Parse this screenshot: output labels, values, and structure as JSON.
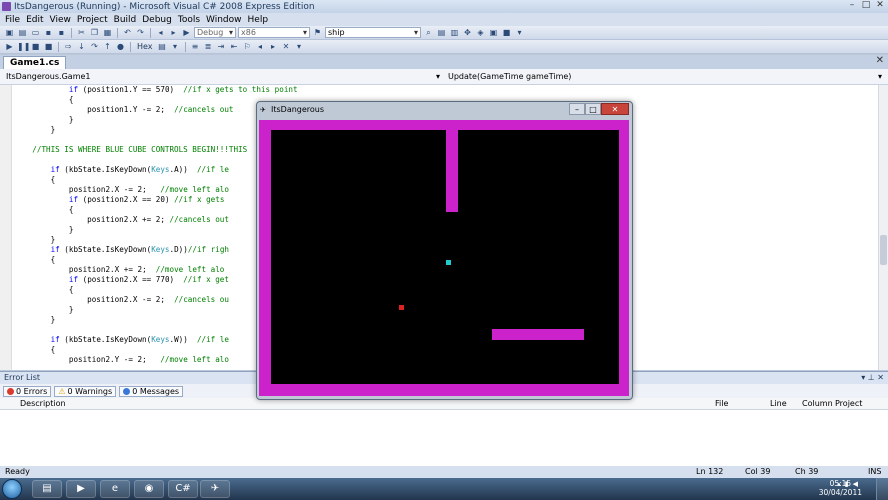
{
  "window": {
    "title": "ItsDangerous (Running) - Microsoft Visual C# 2008 Express Edition"
  },
  "menu": [
    "File",
    "Edit",
    "View",
    "Project",
    "Build",
    "Debug",
    "Tools",
    "Window",
    "Help"
  ],
  "toolbar": {
    "config_value": "Debug",
    "platform_value": "x86",
    "find_value": "ship",
    "hex_label": "Hex"
  },
  "doc_tab": {
    "label": "Game1.cs"
  },
  "nav": {
    "class_combo": "ItsDangerous.Game1",
    "method_combo": "Update(GameTime gameTime)"
  },
  "code_lines": [
    "            if (position1.Y == 570)  //if x gets to this point",
    "            {",
    "                position1.Y -= 2;  //cancels out",
    "            }",
    "        }",
    "",
    "    //THIS IS WHERE BLUE CUBE CONTROLS BEGIN!!!THIS",
    "",
    "        if (kbState.IsKeyDown(Keys.A))  //if le",
    "        {",
    "            position2.X -= 2;   //move left alo",
    "            if (position2.X == 20) //if x gets",
    "            {",
    "                position2.X += 2; //cancels out",
    "            }",
    "        }",
    "        if (kbState.IsKeyDown(Keys.D))//if righ",
    "        {",
    "            position2.X += 2;  //move left alo",
    "            if (position2.X == 770)  //if x get",
    "            {",
    "                position2.X -= 2;  //cancels ou",
    "            }",
    "        }",
    "",
    "        if (kbState.IsKeyDown(Keys.W))  //if le",
    "        {",
    "            position2.Y -= 2;   //move left alo"
  ],
  "error_list": {
    "title": "Error List",
    "errors": "0 Errors",
    "warnings": "0 Warnings",
    "messages": "0 Messages",
    "columns": [
      "Description",
      "File",
      "Line",
      "Column",
      "Project"
    ]
  },
  "status": {
    "text": "Ready",
    "ln": "Ln 132",
    "col": "Col 39",
    "ch": "Ch 39",
    "mode": "INS"
  },
  "game_window": {
    "title": "ItsDangerous",
    "colors": {
      "wall": "#cc22cc",
      "floor": "#000000",
      "player1": "#dd2222",
      "player2": "#22cccc"
    }
  },
  "clock": {
    "time": "05:15",
    "date": "30/04/2011"
  },
  "colors": {
    "keyword": "#0000ff",
    "comment": "#008000",
    "type": "#2b91af"
  }
}
